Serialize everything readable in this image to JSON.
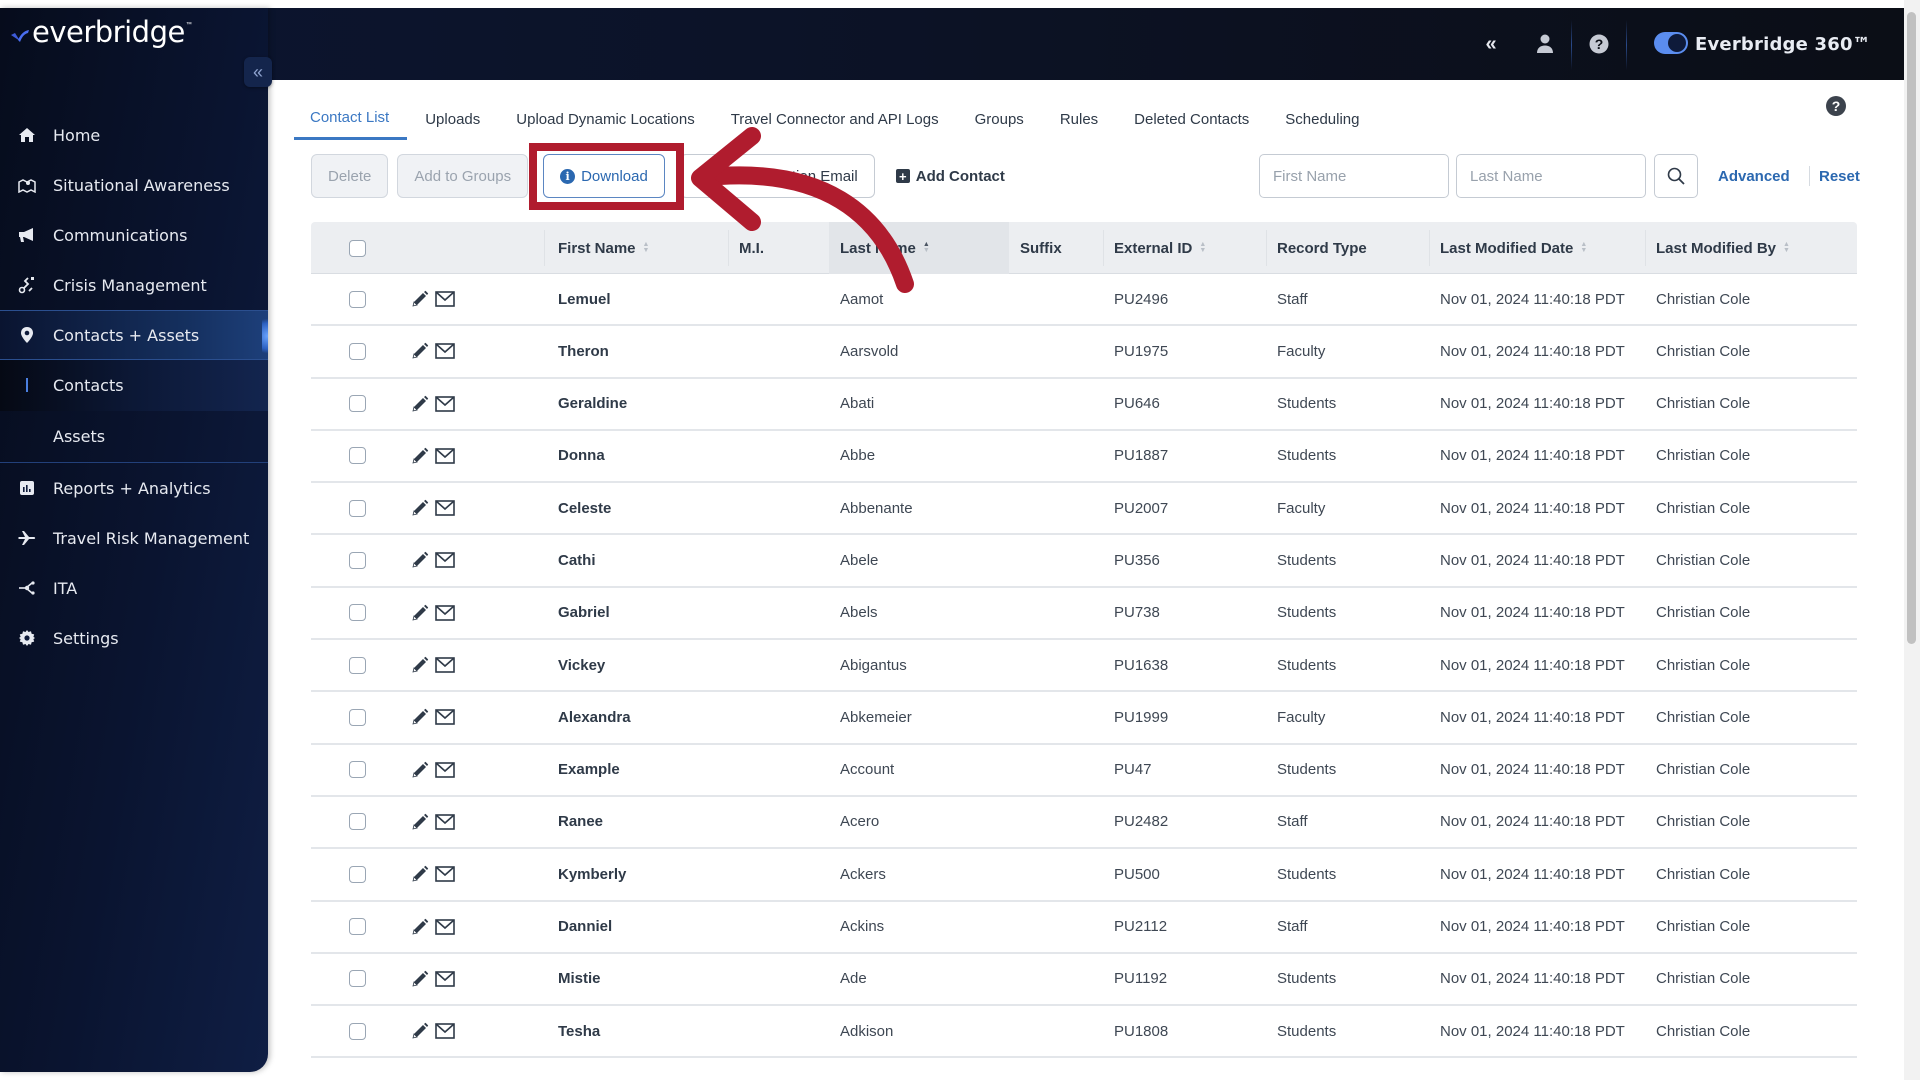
{
  "app": {
    "logo_text": "everbridge",
    "logo_tm": "™",
    "product_label": "Everbridge 360™",
    "product_toggle_on": true
  },
  "header": {
    "icons": [
      "double-chevron-left-icon",
      "user-icon",
      "help-icon"
    ]
  },
  "sidebar": {
    "collapse_icon": "«",
    "items": [
      {
        "label": "Home",
        "icon": "home-icon"
      },
      {
        "label": "Situational Awareness",
        "icon": "map-pin-icon"
      },
      {
        "label": "Communications",
        "icon": "megaphone-icon"
      },
      {
        "label": "Crisis Management",
        "icon": "route-icon"
      },
      {
        "label": "Contacts + Assets",
        "icon": "location-pin-icon",
        "active": true
      },
      {
        "label": "Reports + Analytics",
        "icon": "bar-chart-icon"
      },
      {
        "label": "Travel Risk Management",
        "icon": "airplane-icon"
      },
      {
        "label": "ITA",
        "icon": "network-icon"
      },
      {
        "label": "Settings",
        "icon": "gear-icon"
      }
    ],
    "sub_items": [
      {
        "label": "Contacts",
        "selected": true
      },
      {
        "label": "Assets",
        "selected": false
      }
    ]
  },
  "tabs": [
    {
      "label": "Contact List",
      "active": true
    },
    {
      "label": "Uploads"
    },
    {
      "label": "Upload Dynamic Locations"
    },
    {
      "label": "Travel Connector and API Logs"
    },
    {
      "label": "Groups"
    },
    {
      "label": "Rules"
    },
    {
      "label": "Deleted Contacts"
    },
    {
      "label": "Scheduling"
    }
  ],
  "toolbar": {
    "delete_label": "Delete",
    "add_to_groups_label": "Add to Groups",
    "download_label": "Download",
    "send_registration_label": "Send Registration Email",
    "add_contact_label": "Add Contact"
  },
  "search": {
    "first_name_placeholder": "First Name",
    "first_name_value": "",
    "last_name_placeholder": "Last Name",
    "last_name_value": "",
    "advanced_label": "Advanced",
    "reset_label": "Reset"
  },
  "table": {
    "columns": [
      {
        "label": "First Name",
        "sortable": true
      },
      {
        "label": "M.I.",
        "sortable": false
      },
      {
        "label": "Last Name",
        "sortable": true,
        "sorted": "asc"
      },
      {
        "label": "Suffix",
        "sortable": false
      },
      {
        "label": "External ID",
        "sortable": true
      },
      {
        "label": "Record Type",
        "sortable": false
      },
      {
        "label": "Last Modified Date",
        "sortable": true
      },
      {
        "label": "Last Modified By",
        "sortable": true
      }
    ],
    "rows": [
      {
        "first": "Lemuel",
        "mi": "",
        "last": "Aamot",
        "suffix": "",
        "ext_id": "PU2496",
        "type": "Staff",
        "modified": "Nov 01, 2024 11:40:18 PDT",
        "by": "Christian Cole"
      },
      {
        "first": "Theron",
        "mi": "",
        "last": "Aarsvold",
        "suffix": "",
        "ext_id": "PU1975",
        "type": "Faculty",
        "modified": "Nov 01, 2024 11:40:18 PDT",
        "by": "Christian Cole"
      },
      {
        "first": "Geraldine",
        "mi": "",
        "last": "Abati",
        "suffix": "",
        "ext_id": "PU646",
        "type": "Students",
        "modified": "Nov 01, 2024 11:40:18 PDT",
        "by": "Christian Cole"
      },
      {
        "first": "Donna",
        "mi": "",
        "last": "Abbe",
        "suffix": "",
        "ext_id": "PU1887",
        "type": "Students",
        "modified": "Nov 01, 2024 11:40:18 PDT",
        "by": "Christian Cole"
      },
      {
        "first": "Celeste",
        "mi": "",
        "last": "Abbenante",
        "suffix": "",
        "ext_id": "PU2007",
        "type": "Faculty",
        "modified": "Nov 01, 2024 11:40:18 PDT",
        "by": "Christian Cole"
      },
      {
        "first": "Cathi",
        "mi": "",
        "last": "Abele",
        "suffix": "",
        "ext_id": "PU356",
        "type": "Students",
        "modified": "Nov 01, 2024 11:40:18 PDT",
        "by": "Christian Cole"
      },
      {
        "first": "Gabriel",
        "mi": "",
        "last": "Abels",
        "suffix": "",
        "ext_id": "PU738",
        "type": "Students",
        "modified": "Nov 01, 2024 11:40:18 PDT",
        "by": "Christian Cole"
      },
      {
        "first": "Vickey",
        "mi": "",
        "last": "Abigantus",
        "suffix": "",
        "ext_id": "PU1638",
        "type": "Students",
        "modified": "Nov 01, 2024 11:40:18 PDT",
        "by": "Christian Cole"
      },
      {
        "first": "Alexandra",
        "mi": "",
        "last": "Abkemeier",
        "suffix": "",
        "ext_id": "PU1999",
        "type": "Faculty",
        "modified": "Nov 01, 2024 11:40:18 PDT",
        "by": "Christian Cole"
      },
      {
        "first": "Example",
        "mi": "",
        "last": "Account",
        "suffix": "",
        "ext_id": "PU47",
        "type": "Students",
        "modified": "Nov 01, 2024 11:40:18 PDT",
        "by": "Christian Cole"
      },
      {
        "first": "Ranee",
        "mi": "",
        "last": "Acero",
        "suffix": "",
        "ext_id": "PU2482",
        "type": "Staff",
        "modified": "Nov 01, 2024 11:40:18 PDT",
        "by": "Christian Cole"
      },
      {
        "first": "Kymberly",
        "mi": "",
        "last": "Ackers",
        "suffix": "",
        "ext_id": "PU500",
        "type": "Students",
        "modified": "Nov 01, 2024 11:40:18 PDT",
        "by": "Christian Cole"
      },
      {
        "first": "Danniel",
        "mi": "",
        "last": "Ackins",
        "suffix": "",
        "ext_id": "PU2112",
        "type": "Staff",
        "modified": "Nov 01, 2024 11:40:18 PDT",
        "by": "Christian Cole"
      },
      {
        "first": "Mistie",
        "mi": "",
        "last": "Ade",
        "suffix": "",
        "ext_id": "PU1192",
        "type": "Students",
        "modified": "Nov 01, 2024 11:40:18 PDT",
        "by": "Christian Cole"
      },
      {
        "first": "Tesha",
        "mi": "",
        "last": "Adkison",
        "suffix": "",
        "ext_id": "PU1808",
        "type": "Students",
        "modified": "Nov 01, 2024 11:40:18 PDT",
        "by": "Christian Cole"
      }
    ]
  },
  "annotation": {
    "highlight_target": "Download",
    "color": "#b01c2e"
  }
}
